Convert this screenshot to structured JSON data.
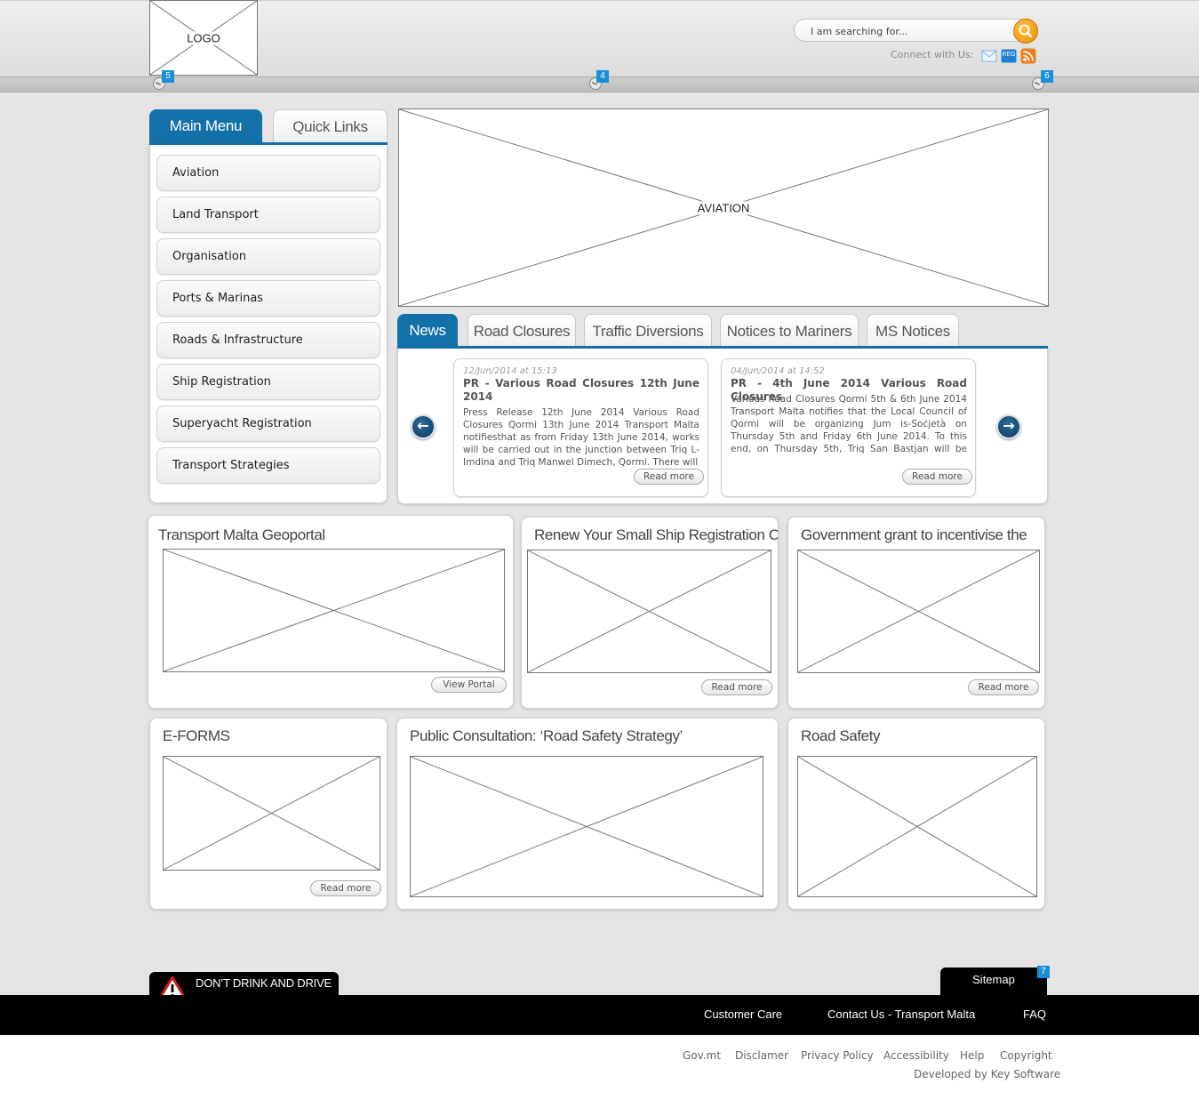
{
  "header": {
    "logo_label": "LOGO",
    "search": {
      "placeholder": "I am searching for..."
    },
    "connect_label": "Connect with Us:",
    "social_icons": [
      "email-icon",
      "reg-icon",
      "rss-icon"
    ],
    "reg_badge_text": "REG",
    "markers": [
      "5",
      "4",
      "6"
    ]
  },
  "menu": {
    "tabs": [
      {
        "label": "Main Menu",
        "active": true
      },
      {
        "label": "Quick Links",
        "active": false
      }
    ],
    "items": [
      "Aviation",
      "Land Transport",
      "Organisation",
      "Ports & Marinas",
      "Roads & Infrastructure",
      "Ship Registration",
      "Superyacht Registration",
      "Transport Strategies"
    ]
  },
  "hero": {
    "label": "AVIATION"
  },
  "news": {
    "tabs": [
      {
        "label": "News",
        "active": true
      },
      {
        "label": "Road Closures",
        "active": false
      },
      {
        "label": "Traffic Diversions",
        "active": false
      },
      {
        "label": "Notices to Mariners",
        "active": false
      },
      {
        "label": "MS Notices",
        "active": false
      }
    ],
    "items": [
      {
        "date": "12/Jun/2014 at 15:13",
        "title": "PR - Various Road Closures 12th June 2014",
        "body": "Press Release      12th June 2014       Various Road Closures    Qormi 13th June 2014   Transport Malta notifiesthat as from Friday 13th June 2014, works will be carried out in the junction between Triq L-Imdina and Triq Manwel Dimech, Qormi. There will",
        "read_more": "Read more"
      },
      {
        "date": "04/Jun/2014 at 14:52",
        "title": "PR - 4th June 2014 Various Road Closures",
        "body": "Various Road Closures    Qormi 5th & 6th June 2014    Transport Malta notifies that the Local Council of Qormi will be organizing Jum is-Soċjetà on Thursday 5th and Friday 6th June 2014.   To this end, on Thursday 5th, Triq San Bastjan will be closed",
        "read_more": "Read more"
      }
    ],
    "prev_icon": "arrow-left-icon",
    "next_icon": "arrow-right-icon"
  },
  "boxes": {
    "geoportal": {
      "title": "Transport Malta Geoportal",
      "button": "View Portal"
    },
    "ship_registration": {
      "title": "Renew Your Small Ship Registration Online",
      "button": "Read more"
    },
    "government_grant": {
      "title": "Government grant to incentivise the",
      "button": "Read more"
    },
    "eforms": {
      "title": "E-FORMS",
      "button": "Read more"
    },
    "consultation": {
      "title": "Public Consultation: ‘Road Safety Strategy’"
    },
    "road_safety": {
      "title": "Road Safety"
    }
  },
  "footer": {
    "dont_drink": "DON’T DRINK AND DRIVE",
    "sitemap": "Sitemap",
    "sitemap_marker": "7",
    "links": [
      "Customer Care",
      "Contact Us - Transport Malta",
      "FAQ"
    ],
    "legal": [
      "Gov.mt",
      "Disclamer",
      "Privacy Policy",
      "Accessibility",
      "Help",
      "Copyright"
    ],
    "developed_by": "Developed by Key Software"
  },
  "colors": {
    "accent": "#1470a8",
    "search_button": "#f08c00",
    "footer": "#000000",
    "marker": "#1a8fd8"
  }
}
